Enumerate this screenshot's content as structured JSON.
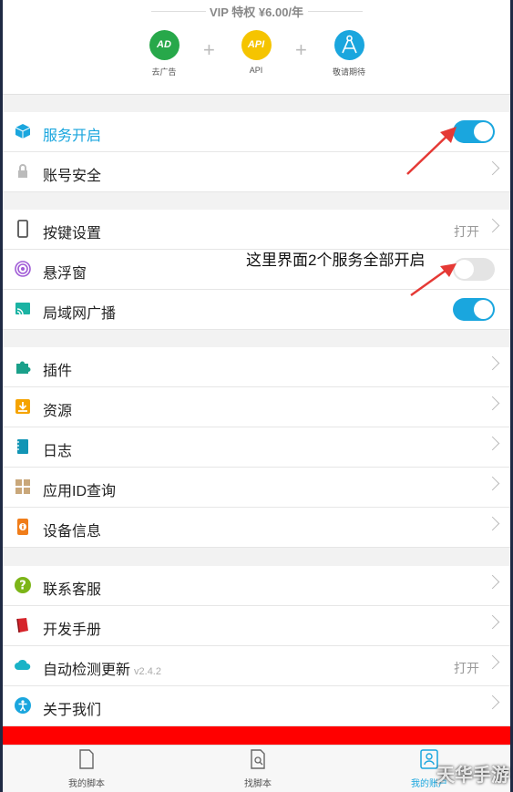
{
  "vip": {
    "title": "VIP 特权   ¥6.00/年",
    "perks": [
      {
        "icon": "ad-off-icon",
        "label": "去广告",
        "badge": "AD",
        "color": "#27a84a"
      },
      {
        "icon": "api-icon",
        "label": "API",
        "badge": "API",
        "color": "#f5c400"
      },
      {
        "icon": "compass-icon",
        "label": "敬请期待",
        "badge": "",
        "color": "#1aa6de"
      }
    ]
  },
  "rows": {
    "service": {
      "label": "服务开启",
      "icon": "cube-icon",
      "toggle": "on"
    },
    "account": {
      "label": "账号安全",
      "icon": "lock-icon"
    },
    "keys": {
      "label": "按键设置",
      "icon": "phone-icon",
      "value": "打开"
    },
    "floating": {
      "label": "悬浮窗",
      "icon": "target-icon",
      "toggle": "off"
    },
    "lan": {
      "label": "局域网广播",
      "icon": "cast-icon",
      "toggle": "on"
    },
    "plugins": {
      "label": "插件",
      "icon": "puzzle-icon"
    },
    "resources": {
      "label": "资源",
      "icon": "download-box-icon"
    },
    "logs": {
      "label": "日志",
      "icon": "notebook-icon"
    },
    "appid": {
      "label": "应用ID查询",
      "icon": "grid-icon"
    },
    "device": {
      "label": "设备信息",
      "icon": "device-info-icon"
    },
    "support": {
      "label": "联系客服",
      "icon": "question-icon"
    },
    "manual": {
      "label": "开发手册",
      "icon": "book-icon"
    },
    "update": {
      "label": "自动检测更新",
      "icon": "cloud-icon",
      "version": "v2.4.2",
      "value": "打开"
    },
    "about": {
      "label": "关于我们",
      "icon": "person-icon"
    }
  },
  "annotation": {
    "text": "这里界面2个服务全部开启"
  },
  "tabs": [
    {
      "label": "我的脚本",
      "icon": "file-icon"
    },
    {
      "label": "找脚本",
      "icon": "search-file-icon"
    },
    {
      "label": "我的账户",
      "icon": "user-icon",
      "active": true
    }
  ],
  "watermark": "天华手游",
  "colors": {
    "accent": "#1aa6de",
    "annotation_arrow": "#e53935",
    "logout": "#ff0000"
  }
}
